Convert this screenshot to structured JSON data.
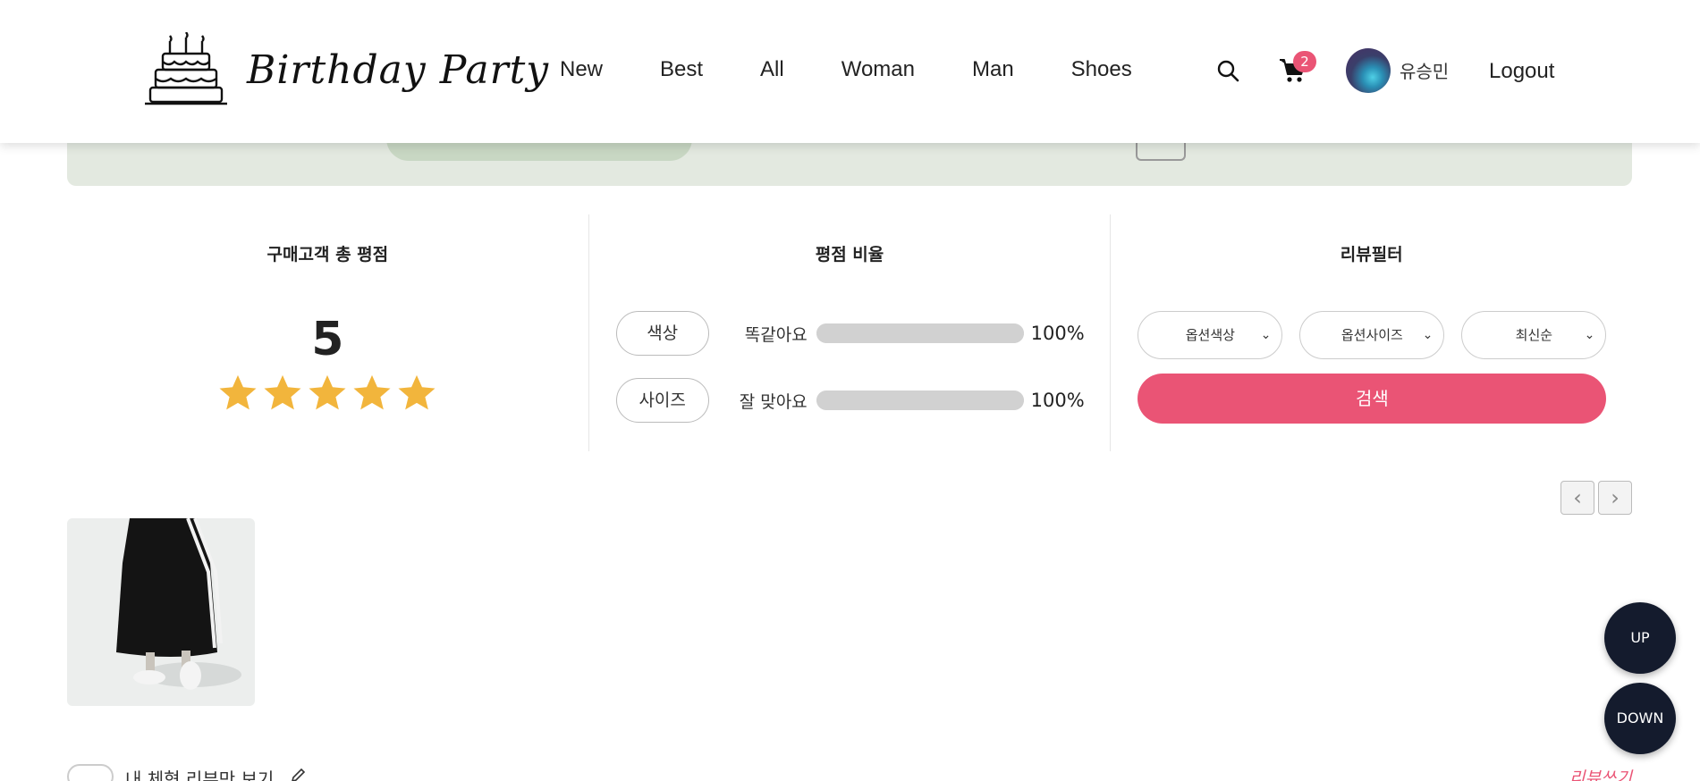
{
  "header": {
    "logo_text": "Birthday Party",
    "nav": [
      "New",
      "Best",
      "All",
      "Woman",
      "Man",
      "Shoes"
    ],
    "cart_count": "2",
    "username": "유승민",
    "logout": "Logout"
  },
  "summary": {
    "total_title": "구매고객 총 평점",
    "score": "5",
    "stars": 5,
    "ratio_title": "평점 비율",
    "ratios": [
      {
        "tag": "색상",
        "label": "똑같아요",
        "percent": "100%",
        "fraction": 1.0
      },
      {
        "tag": "사이즈",
        "label": "잘 맞아요",
        "percent": "100%",
        "fraction": 1.0
      }
    ],
    "filter_title": "리뷰필터",
    "filters": [
      "옵션색상",
      "옵션사이즈",
      "최신순"
    ],
    "search_label": "검색"
  },
  "pager": {
    "prev": "‹",
    "next": "›"
  },
  "footer": {
    "body_only": "내 체형 리뷰만 보기",
    "write_review": "리뷰쓰기"
  },
  "float": {
    "up": "UP",
    "down": "DOWN"
  },
  "colors": {
    "accent": "#ea5475",
    "star": "#f2b53c",
    "float_bg": "#141b2d",
    "banner_bg": "#e3e9e0"
  }
}
